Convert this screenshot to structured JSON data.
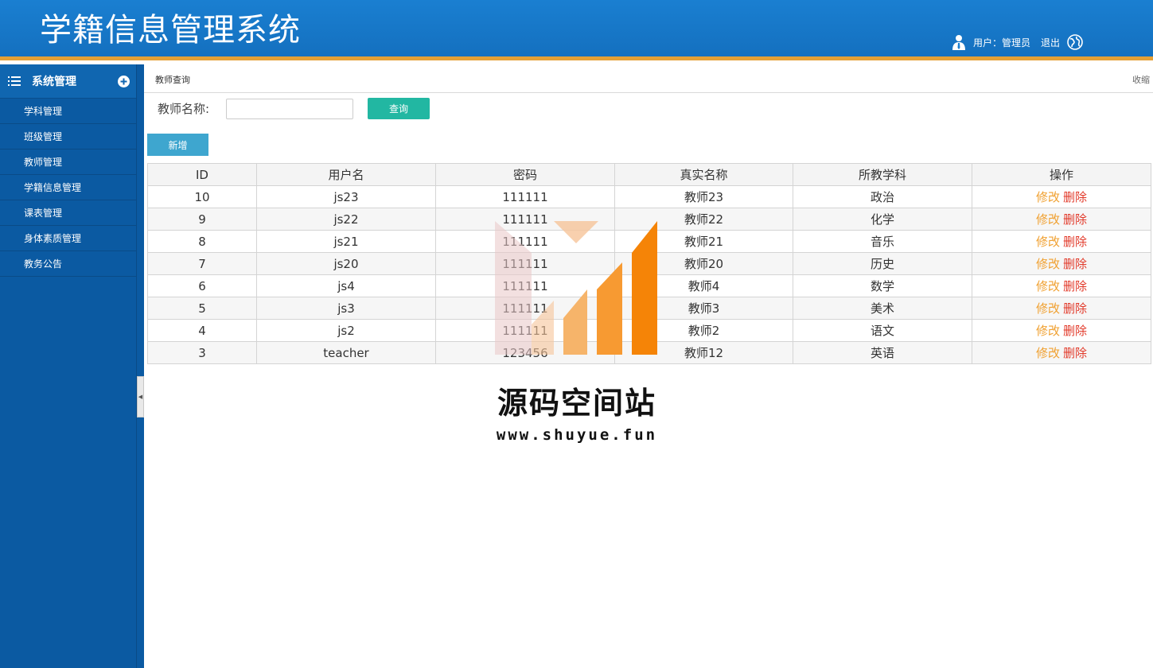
{
  "header": {
    "title": "学籍信息管理系统",
    "user_label": "用户：管理员",
    "logout_label": "退出"
  },
  "sidebar": {
    "heading": "系统管理",
    "items": [
      {
        "label": "学科管理"
      },
      {
        "label": "班级管理"
      },
      {
        "label": "教师管理"
      },
      {
        "label": "学籍信息管理"
      },
      {
        "label": "课表管理"
      },
      {
        "label": "身体素质管理"
      },
      {
        "label": "教务公告"
      }
    ]
  },
  "main": {
    "breadcrumb": "教师查询",
    "collapse_label": "收缩",
    "search": {
      "label": "教师名称:",
      "value": "",
      "placeholder": "",
      "button_label": "查询"
    },
    "add_label": "新增",
    "table": {
      "columns": [
        "ID",
        "用户名",
        "密码",
        "真实名称",
        "所教学科",
        "操作"
      ],
      "rows": [
        {
          "id": "10",
          "username": "js23",
          "password": "111111",
          "realname": "教师23",
          "subject": "政治"
        },
        {
          "id": "9",
          "username": "js22",
          "password": "111111",
          "realname": "教师22",
          "subject": "化学"
        },
        {
          "id": "8",
          "username": "js21",
          "password": "111111",
          "realname": "教师21",
          "subject": "音乐"
        },
        {
          "id": "7",
          "username": "js20",
          "password": "111111",
          "realname": "教师20",
          "subject": "历史"
        },
        {
          "id": "6",
          "username": "js4",
          "password": "111111",
          "realname": "教师4",
          "subject": "数学"
        },
        {
          "id": "5",
          "username": "js3",
          "password": "111111",
          "realname": "教师3",
          "subject": "美术"
        },
        {
          "id": "4",
          "username": "js2",
          "password": "111111",
          "realname": "教师2",
          "subject": "语文"
        },
        {
          "id": "3",
          "username": "teacher",
          "password": "123456",
          "realname": "教师12",
          "subject": "英语"
        }
      ],
      "edit_label": "修改",
      "delete_label": "删除"
    }
  },
  "watermark": {
    "text": "源码空间站",
    "url": "www.shuyue.fun"
  },
  "colors": {
    "header_bg": "#1a7fd1",
    "header_accent": "#e5a035",
    "sidebar_bg": "#0b5aa2",
    "search_button": "#22b7a2",
    "add_button": "#3ea6cf",
    "edit_link": "#f0a030",
    "delete_link": "#e23a2a"
  }
}
